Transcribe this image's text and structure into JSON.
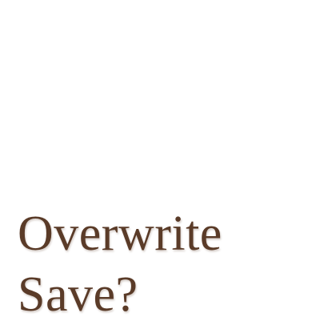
{
  "dialog": {
    "prompt_line1": "Overwrite",
    "prompt_line2": "Save?"
  },
  "colors": {
    "background": "#ffffff",
    "text": "#5a3b28"
  }
}
